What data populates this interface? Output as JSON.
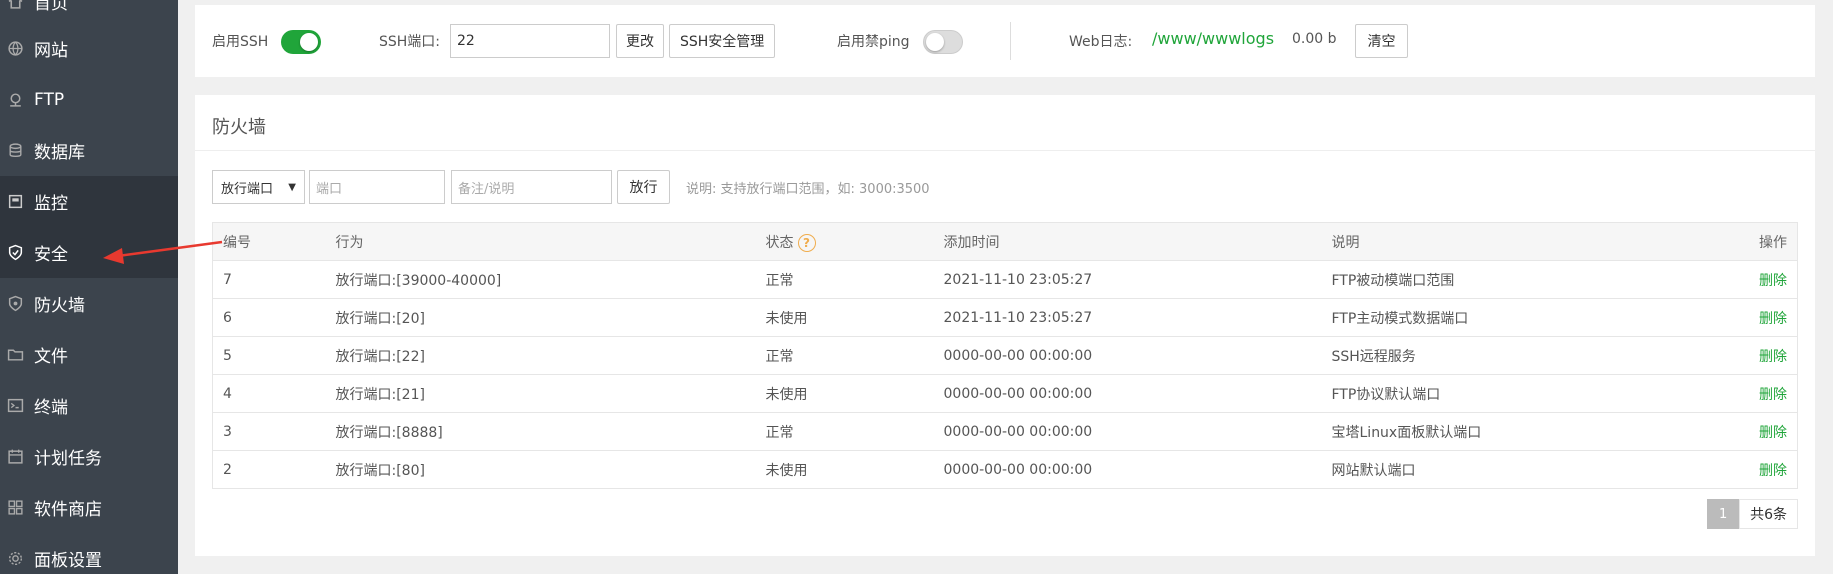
{
  "sidebar": {
    "items": [
      {
        "label": "首页",
        "icon": "home-icon"
      },
      {
        "label": "网站",
        "icon": "globe-icon"
      },
      {
        "label": "FTP",
        "icon": "ftp-icon"
      },
      {
        "label": "数据库",
        "icon": "database-icon"
      },
      {
        "label": "监控",
        "icon": "monitor-icon"
      },
      {
        "label": "安全",
        "icon": "shield-check-icon"
      },
      {
        "label": "防火墙",
        "icon": "firewall-icon"
      },
      {
        "label": "文件",
        "icon": "folder-icon"
      },
      {
        "label": "终端",
        "icon": "terminal-icon"
      },
      {
        "label": "计划任务",
        "icon": "calendar-icon"
      },
      {
        "label": "软件商店",
        "icon": "grid-icon"
      },
      {
        "label": "面板设置",
        "icon": "gear-icon"
      }
    ]
  },
  "top": {
    "ssh_label": "启用SSH",
    "ssh_enabled": true,
    "ssh_port_label": "SSH端口:",
    "ssh_port_value": "22",
    "change_btn": "更改",
    "ssh_manage_btn": "SSH安全管理",
    "ping_label": "启用禁ping",
    "ping_enabled": false,
    "weblog_label": "Web日志:",
    "weblog_path": "/www/wwwlogs",
    "weblog_size": "0.00 b",
    "clear_btn": "清空"
  },
  "firewall": {
    "title": "防火墙",
    "select_value": "放行端口",
    "port_placeholder": "端口",
    "note_placeholder": "备注/说明",
    "allow_btn": "放行",
    "hint": "说明: 支持放行端口范围，如: 3000:3500",
    "columns": [
      "编号",
      "行为",
      "状态",
      "添加时间",
      "说明",
      "操作"
    ],
    "rows": [
      {
        "id": "7",
        "action": "放行端口:[39000-40000]",
        "status": "正常",
        "time": "2021-11-10 23:05:27",
        "note": "FTP被动模端口范围",
        "op": "删除"
      },
      {
        "id": "6",
        "action": "放行端口:[20]",
        "status": "未使用",
        "time": "2021-11-10 23:05:27",
        "note": "FTP主动模式数据端口",
        "op": "删除"
      },
      {
        "id": "5",
        "action": "放行端口:[22]",
        "status": "正常",
        "time": "0000-00-00 00:00:00",
        "note": "SSH远程服务",
        "op": "删除"
      },
      {
        "id": "4",
        "action": "放行端口:[21]",
        "status": "未使用",
        "time": "0000-00-00 00:00:00",
        "note": "FTP协议默认端口",
        "op": "删除"
      },
      {
        "id": "3",
        "action": "放行端口:[8888]",
        "status": "正常",
        "time": "0000-00-00 00:00:00",
        "note": "宝塔Linux面板默认端口",
        "op": "删除"
      },
      {
        "id": "2",
        "action": "放行端口:[80]",
        "status": "未使用",
        "time": "0000-00-00 00:00:00",
        "note": "网站默认端口",
        "op": "删除"
      }
    ],
    "pager_current": "1",
    "pager_total": "共6条"
  },
  "colors": {
    "sidebar_bg": "#3c444d",
    "accent_green": "#20a53a",
    "arrow_red": "#e8392f"
  }
}
